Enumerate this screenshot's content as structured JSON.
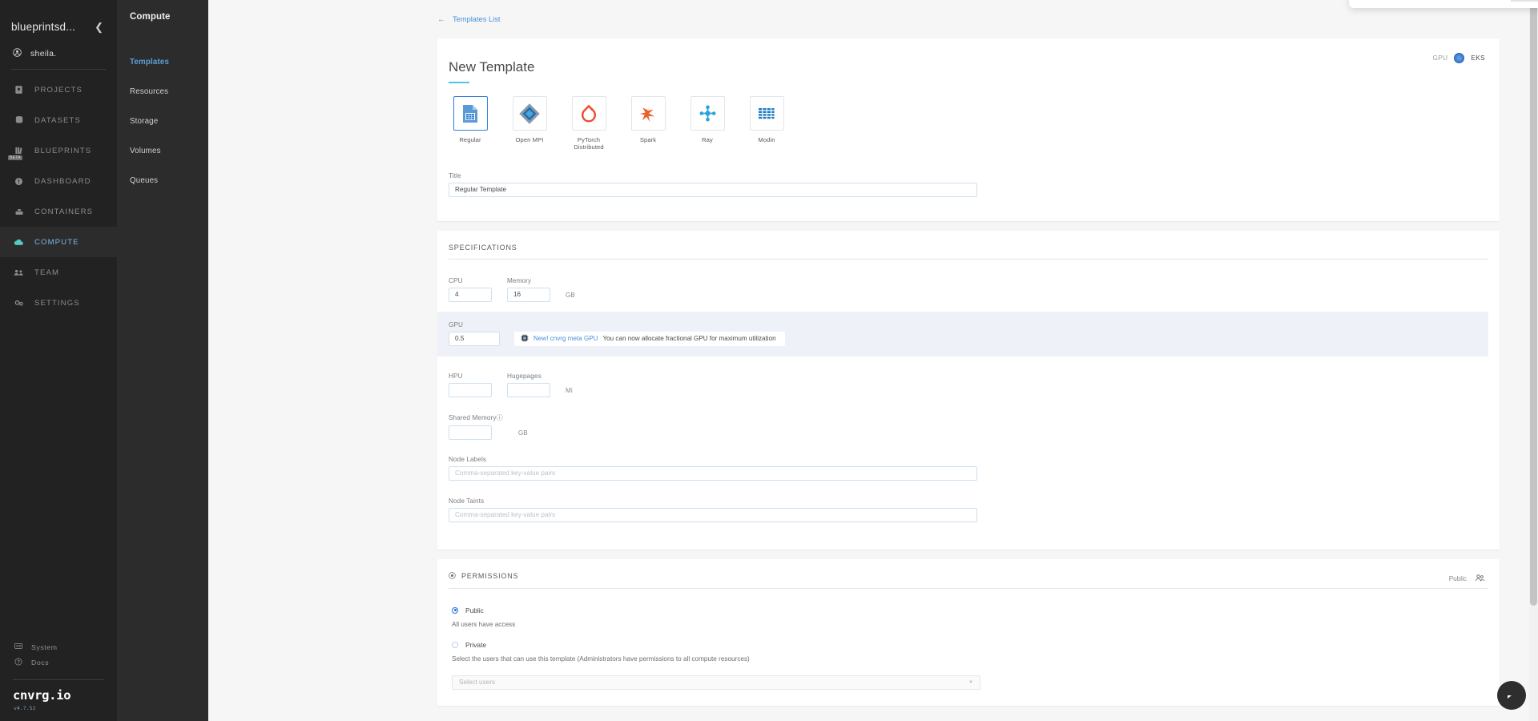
{
  "sidebar": {
    "org_name": "blueprintsd...",
    "collapse_icon": "chevron-left-icon",
    "user_name": "sheila.",
    "items": [
      {
        "label": "PROJECTS",
        "icon": "projects-icon",
        "active": false
      },
      {
        "label": "DATASETS",
        "icon": "datasets-icon",
        "active": false
      },
      {
        "label": "BLUEPRINTS",
        "icon": "blueprints-icon",
        "active": false,
        "badge": "BETA"
      },
      {
        "label": "DASHBOARD",
        "icon": "dashboard-icon",
        "active": false
      },
      {
        "label": "CONTAINERS",
        "icon": "containers-icon",
        "active": false
      },
      {
        "label": "COMPUTE",
        "icon": "compute-cloud-icon",
        "active": true
      },
      {
        "label": "TEAM",
        "icon": "team-icon",
        "active": false
      },
      {
        "label": "SETTINGS",
        "icon": "settings-gear-icon",
        "active": false
      }
    ],
    "bottom_items": [
      {
        "label": "System",
        "icon": "system-icon"
      },
      {
        "label": "Docs",
        "icon": "docs-help-icon"
      }
    ],
    "logo": "cnvrg.io",
    "version": "v4.7.52"
  },
  "subnav": {
    "title": "Compute",
    "items": [
      {
        "label": "Templates",
        "active": true
      },
      {
        "label": "Resources",
        "active": false
      },
      {
        "label": "Storage",
        "active": false
      },
      {
        "label": "Volumes",
        "active": false
      },
      {
        "label": "Queues",
        "active": false
      }
    ]
  },
  "breadcrumb": {
    "back_icon": "arrow-left-icon",
    "label": "Templates List"
  },
  "template_form": {
    "page_title": "New Template",
    "cluster_toggle": {
      "left_label": "GPU",
      "right_label": "EKS",
      "selected": "EKS"
    },
    "types": [
      {
        "label": "Regular",
        "icon": "regular-file-grid-icon",
        "selected": true
      },
      {
        "label": "Open MPI",
        "icon": "open-mpi-diamond-icon",
        "selected": false
      },
      {
        "label": "PyTorch Distributed",
        "icon": "pytorch-flame-icon",
        "selected": false
      },
      {
        "label": "Spark",
        "icon": "spark-star-icon",
        "selected": false
      },
      {
        "label": "Ray",
        "icon": "ray-nodes-icon",
        "selected": false
      },
      {
        "label": "Modin",
        "icon": "modin-bars-icon",
        "selected": false
      }
    ],
    "title_field": {
      "label": "Title",
      "value": "Regular Template",
      "placeholder": ""
    }
  },
  "specifications": {
    "heading": "SPECIFICATIONS",
    "cpu": {
      "label": "CPU",
      "value": "4",
      "unit": ""
    },
    "memory": {
      "label": "Memory",
      "value": "16",
      "unit": "GB"
    },
    "gpu": {
      "label": "GPU",
      "value": "0.5",
      "unit": ""
    },
    "gpu_promo": {
      "icon": "cnvrg-meta-gpu-icon",
      "link_text": "New! cnvrg meta GPU",
      "rest_text": " You can now allocate fractional GPU for maximum utilization"
    },
    "hpu": {
      "label": "HPU",
      "value": "",
      "placeholder": "",
      "unit": ""
    },
    "hugepages": {
      "label": "Hugepages",
      "value": "",
      "placeholder": "",
      "unit": "Mi"
    },
    "shared_memory": {
      "label": "Shared Memory",
      "info_icon": "info-circle-icon",
      "value": "",
      "unit": "GB"
    },
    "node_labels": {
      "label": "Node Labels",
      "value": "",
      "placeholder": "Comma-separated key-value pairs"
    },
    "node_taints": {
      "label": "Node Taints",
      "value": "",
      "placeholder": "Comma-separated key-value pairs"
    }
  },
  "permissions": {
    "heading": "PERMISSIONS",
    "heading_icon": "permissions-circle-icon",
    "status_label": "Public",
    "status_icon": "users-group-icon",
    "options": [
      {
        "label": "Public",
        "selected": true,
        "helper": "All users have access"
      },
      {
        "label": "Private",
        "selected": false,
        "helper": "Select the users that can use this template (Administrators have permissions to all compute resources)"
      }
    ],
    "user_select": {
      "placeholder": "Select users",
      "chevron_icon": "chevron-down-icon"
    }
  },
  "widgets": {
    "intercom_icon": "intercom-chat-icon"
  },
  "colors": {
    "accent_blue": "#4a90d9",
    "title_underline": "#4fc3e8",
    "sidebar_bg": "#222222",
    "subnav_bg": "#2c2c2c",
    "gpu_band": "#eef2f8",
    "selected_border": "#2f7ed8"
  }
}
